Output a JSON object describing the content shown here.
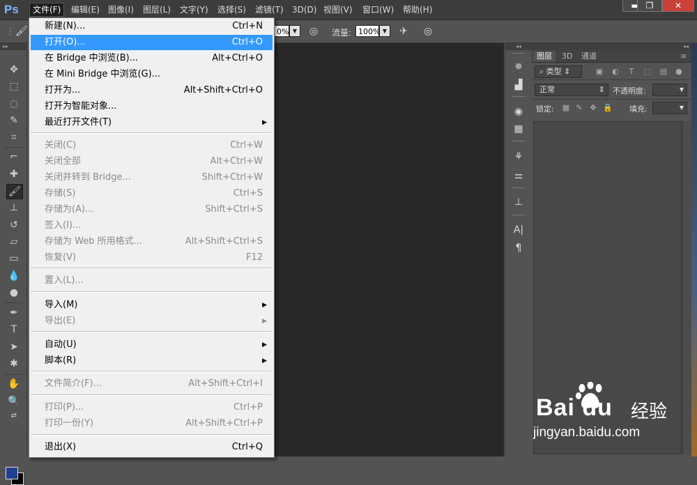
{
  "app": {
    "logo": "Ps"
  },
  "menubar": {
    "items": [
      "文件(F)",
      "编辑(E)",
      "图像(I)",
      "图层(L)",
      "文字(Y)",
      "选择(S)",
      "滤镜(T)",
      "3D(D)",
      "视图(V)",
      "窗口(W)",
      "帮助(H)"
    ],
    "active_index": 0
  },
  "window_controls": {
    "minimize": "▬",
    "restore": "❐",
    "close": "✕"
  },
  "options_bar": {
    "opacity_value": "0%",
    "flow_label": "流量:",
    "flow_value": "100%"
  },
  "file_menu": {
    "items": [
      {
        "label": "新建(N)...",
        "shortcut": "Ctrl+N",
        "enabled": true
      },
      {
        "label": "打开(O)...",
        "shortcut": "Ctrl+O",
        "enabled": true,
        "highlighted": true
      },
      {
        "label": "在 Bridge 中浏览(B)...",
        "shortcut": "Alt+Ctrl+O",
        "enabled": true
      },
      {
        "label": "在 Mini Bridge 中浏览(G)...",
        "shortcut": "",
        "enabled": true
      },
      {
        "label": "打开为...",
        "shortcut": "Alt+Shift+Ctrl+O",
        "enabled": true
      },
      {
        "label": "打开为智能对象...",
        "shortcut": "",
        "enabled": true
      },
      {
        "label": "最近打开文件(T)",
        "shortcut": "",
        "enabled": true,
        "submenu": true
      },
      {
        "label": "关闭(C)",
        "shortcut": "Ctrl+W",
        "enabled": false
      },
      {
        "label": "关闭全部",
        "shortcut": "Alt+Ctrl+W",
        "enabled": false
      },
      {
        "label": "关闭并转到 Bridge...",
        "shortcut": "Shift+Ctrl+W",
        "enabled": false
      },
      {
        "label": "存储(S)",
        "shortcut": "Ctrl+S",
        "enabled": false
      },
      {
        "label": "存储为(A)...",
        "shortcut": "Shift+Ctrl+S",
        "enabled": false
      },
      {
        "label": "签入(I)...",
        "shortcut": "",
        "enabled": false
      },
      {
        "label": "存储为 Web 所用格式...",
        "shortcut": "Alt+Shift+Ctrl+S",
        "enabled": false
      },
      {
        "label": "恢复(V)",
        "shortcut": "F12",
        "enabled": false
      },
      {
        "label": "置入(L)...",
        "shortcut": "",
        "enabled": false
      },
      {
        "label": "导入(M)",
        "shortcut": "",
        "enabled": true,
        "submenu": true
      },
      {
        "label": "导出(E)",
        "shortcut": "",
        "enabled": false,
        "submenu": true
      },
      {
        "label": "自动(U)",
        "shortcut": "",
        "enabled": true,
        "submenu": true
      },
      {
        "label": "脚本(R)",
        "shortcut": "",
        "enabled": true,
        "submenu": true
      },
      {
        "label": "文件简介(F)...",
        "shortcut": "Alt+Shift+Ctrl+I",
        "enabled": false
      },
      {
        "label": "打印(P)...",
        "shortcut": "Ctrl+P",
        "enabled": false
      },
      {
        "label": "打印一份(Y)",
        "shortcut": "Alt+Shift+Ctrl+P",
        "enabled": false
      },
      {
        "label": "退出(X)",
        "shortcut": "Ctrl+Q",
        "enabled": true
      }
    ]
  },
  "layers_panel": {
    "tabs": [
      "图层",
      "3D",
      "通道"
    ],
    "active_tab": 0,
    "filter_label": "类型",
    "blend_mode": "正常",
    "opacity_label": "不透明度:",
    "lock_label": "锁定:",
    "fill_label": "填充:"
  },
  "watermark": {
    "brand": "Bai  du",
    "cn": "经验",
    "url": "jingyan.baidu.com"
  },
  "colors": {
    "accent": "#3399ff",
    "foreground_swatch": "#1f3f8f",
    "background_swatch": "#000000"
  }
}
